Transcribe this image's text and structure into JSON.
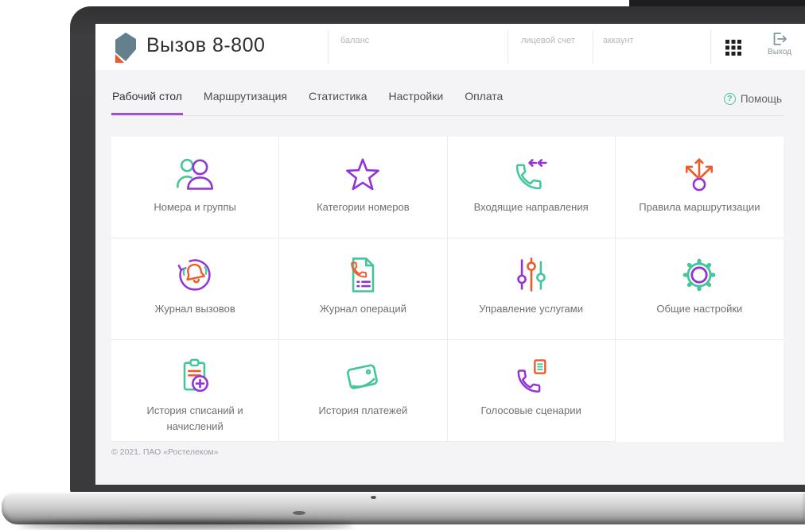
{
  "brand": {
    "title": "Вызов 8-800",
    "logo_icon": "rostelecom-logo",
    "copyright": "© 2021. ПАО «Ростелеком»"
  },
  "header": {
    "balance_label": "баланс",
    "personal_account_label": "лицевой счет",
    "account_label": "аккаунт",
    "apps_icon": "apps-grid-icon",
    "logout": {
      "label": "Выход",
      "icon": "logout-icon"
    }
  },
  "nav": {
    "tabs": [
      {
        "label": "Рабочий стол",
        "active": true
      },
      {
        "label": "Маршрутизация",
        "active": false
      },
      {
        "label": "Статистика",
        "active": false
      },
      {
        "label": "Настройки",
        "active": false
      },
      {
        "label": "Оплата",
        "active": false
      }
    ],
    "help": {
      "label": "Помощь",
      "icon": "question-circle-icon",
      "glyph": "?"
    }
  },
  "tiles": [
    {
      "label": "Номера и группы",
      "icon": "users-icon"
    },
    {
      "label": "Категории номеров",
      "icon": "star-icon"
    },
    {
      "label": "Входящие направления",
      "icon": "phone-incoming-icon"
    },
    {
      "label": "Правила маршрутизации",
      "icon": "route-branch-icon"
    },
    {
      "label": "Журнал вызовов",
      "icon": "bell-refresh-icon"
    },
    {
      "label": "Журнал операций",
      "icon": "phone-document-icon"
    },
    {
      "label": "Управление услугами",
      "icon": "sliders-icon"
    },
    {
      "label": "Общие настройки",
      "icon": "gear-icon"
    },
    {
      "label": "История списаний и начислений",
      "icon": "clipboard-plus-icon"
    },
    {
      "label": "История платежей",
      "icon": "wallet-icon"
    },
    {
      "label": "Голосовые сценарии",
      "icon": "phone-script-icon"
    }
  ],
  "colors": {
    "purple": "#9433d6",
    "green": "#43c69c",
    "orange": "#f05a28",
    "active_underline": "#a24fd6",
    "title_text": "#2f2f2f",
    "tile_text": "#707070",
    "muted_label": "#b5b8bc",
    "logout_icon": "#7f98a1",
    "footer_text": "#9aa0a8"
  }
}
